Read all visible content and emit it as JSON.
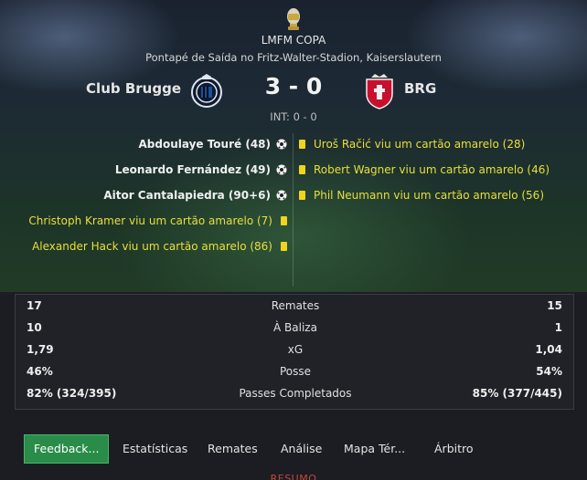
{
  "competition": {
    "name": "LMFM COPA",
    "icon": "trophy-icon"
  },
  "venue": "Pontapé de Saída no Fritz-Walter-Stadion, Kaiserslautern",
  "home": {
    "name": "Club Brugge",
    "crest": "club-brugge-crest",
    "color": "#1a4fa0"
  },
  "away": {
    "name": "BRG",
    "crest": "braga-crest",
    "color": "#c8102e"
  },
  "score": "3 - 0",
  "halftime": "INT: 0 - 0",
  "events": {
    "home": [
      {
        "text": "Abdoulaye Touré (48)",
        "type": "goal",
        "icon": "football-icon"
      },
      {
        "text": "Leonardo Fernández (49)",
        "type": "goal",
        "icon": "football-icon"
      },
      {
        "text": "Aitor Cantalapiedra (90+6)",
        "type": "goal",
        "icon": "football-icon"
      },
      {
        "text": "Christoph Kramer viu um cartão amarelo (7)",
        "type": "card",
        "icon": "yellow-card-icon"
      },
      {
        "text": "Alexander Hack viu um cartão amarelo (86)",
        "type": "card",
        "icon": "yellow-card-icon"
      }
    ],
    "away": [
      {
        "text": "Uroš Račić viu um cartão amarelo (28)",
        "type": "card",
        "icon": "yellow-card-icon"
      },
      {
        "text": "Robert Wagner viu um cartão amarelo (46)",
        "type": "card",
        "icon": "yellow-card-icon"
      },
      {
        "text": "Phil Neumann viu um cartão amarelo (56)",
        "type": "card",
        "icon": "yellow-card-icon"
      }
    ]
  },
  "stats": [
    {
      "label": "Remates",
      "home": "17",
      "away": "15"
    },
    {
      "label": "À Baliza",
      "home": "10",
      "away": "1"
    },
    {
      "label": "xG",
      "home": "1,79",
      "away": "1,04"
    },
    {
      "label": "Posse",
      "home": "46%",
      "away": "54%"
    },
    {
      "label": "Passes Completados",
      "home": "82% (324/395)",
      "away": "85% (377/445)"
    }
  ],
  "tabs": [
    {
      "label": "Feedback...",
      "active": true
    },
    {
      "label": "Estatísticas",
      "active": false
    },
    {
      "label": "Remates",
      "active": false
    },
    {
      "label": "Análise",
      "active": false
    },
    {
      "label": "Mapa Tér...",
      "active": false
    },
    {
      "label": "Árbitro",
      "active": false
    }
  ],
  "bottom_label": "RESUMO",
  "colors": {
    "goal_text": "#f0f0f0",
    "card_text": "#e9df3a",
    "yellow_card": "#f1d51d",
    "accent": "#2a8c49"
  }
}
